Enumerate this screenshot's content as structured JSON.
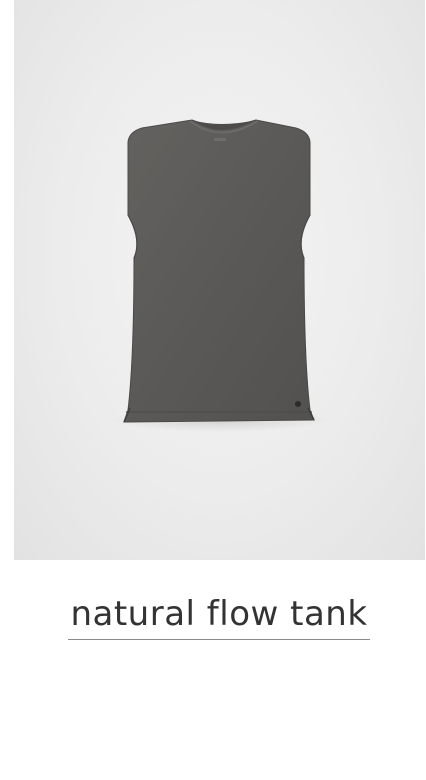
{
  "product": {
    "name": "natural flow tank",
    "garment_color": "#5b5a58",
    "background_color": "#ececec",
    "text_color": "#333333"
  }
}
